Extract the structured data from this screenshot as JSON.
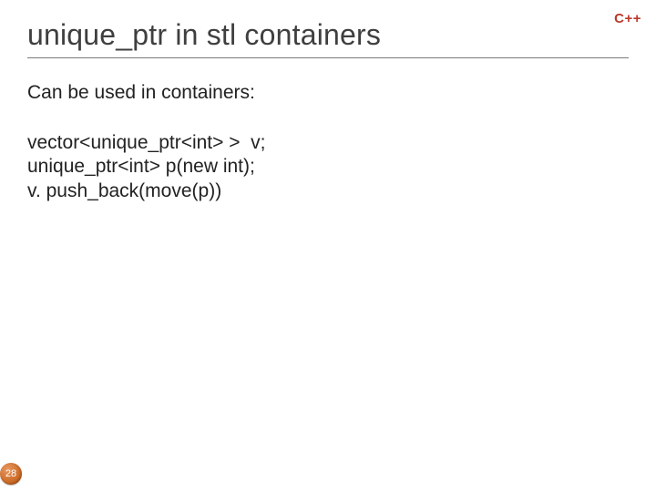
{
  "badge": "C++",
  "title": "unique_ptr in stl containers",
  "subtitle": "Can be used in containers:",
  "code": {
    "line1": "vector<unique_ptr<int> >  v;",
    "line2": "unique_ptr<int> p(new int);",
    "line3": "v. push_back(move(p))"
  },
  "pageNumber": "28"
}
